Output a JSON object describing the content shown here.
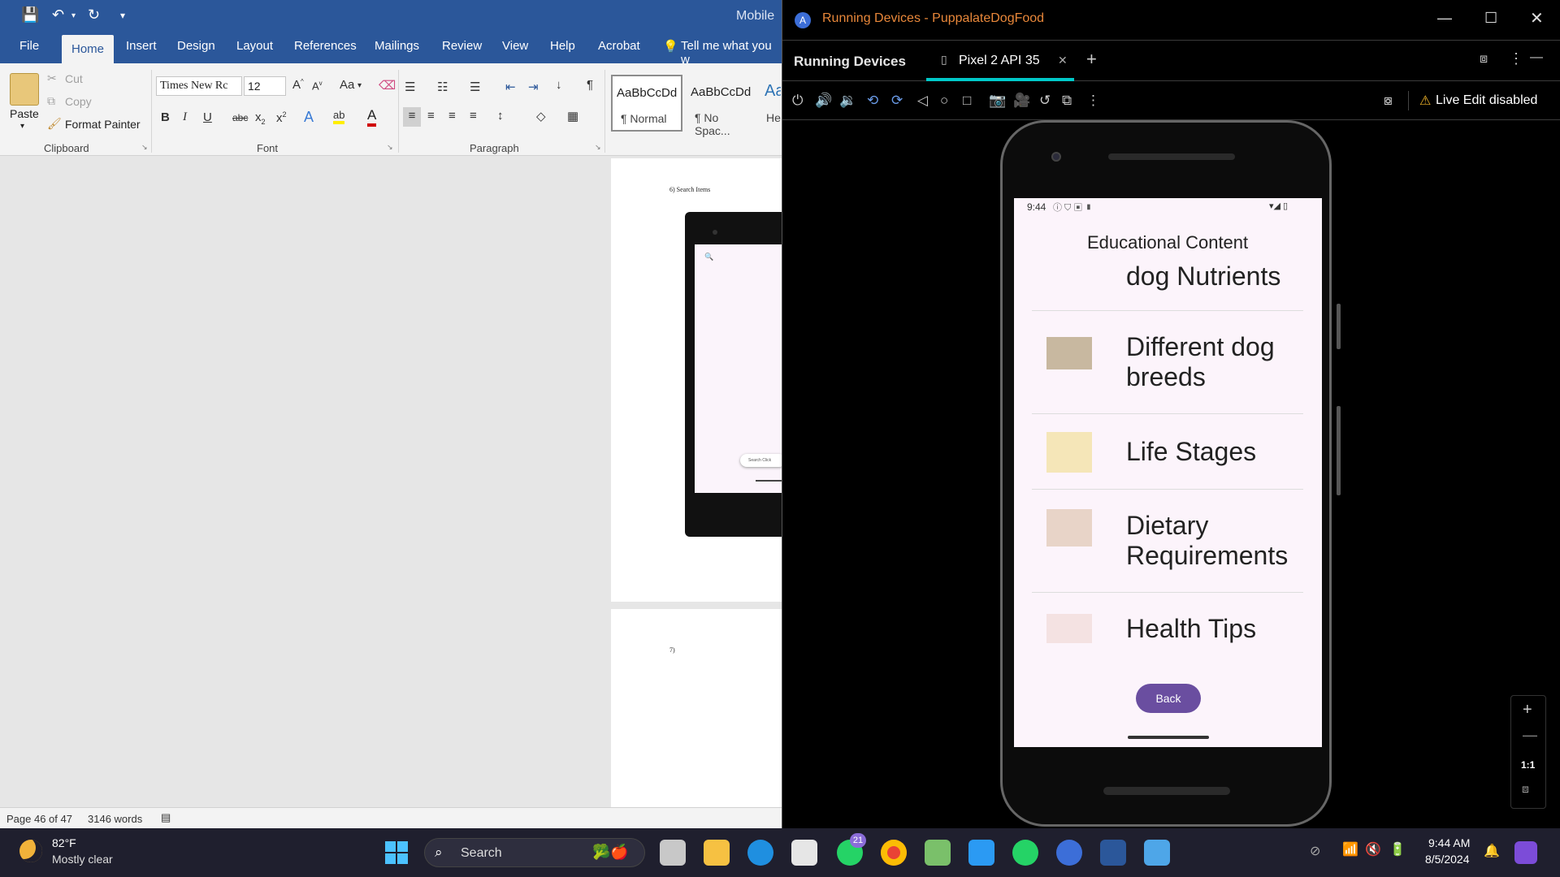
{
  "word": {
    "qat_title": "Mobile",
    "tabs": [
      "File",
      "Home",
      "Insert",
      "Design",
      "Layout",
      "References",
      "Mailings",
      "Review",
      "View",
      "Help",
      "Acrobat",
      "Tell me what you w"
    ],
    "clipboard": {
      "paste": "Paste",
      "cut": "Cut",
      "copy": "Copy",
      "format_painter": "Format Painter",
      "label": "Clipboard"
    },
    "font": {
      "name": "Times New Rc",
      "size": "12",
      "label": "Font",
      "aa": "Aa"
    },
    "paragraph": {
      "label": "Paragraph"
    },
    "styles": [
      {
        "preview": "AaBbCcDd",
        "name": "¶ Normal"
      },
      {
        "preview": "AaBbCcDd",
        "name": "¶ No Spac..."
      },
      {
        "preview": "Aa",
        "name": "He"
      }
    ],
    "page1_caption": "6) Search Items",
    "page2_caption": "7)",
    "thumb_search_text": "Search Click",
    "status": {
      "page": "Page 46 of 47",
      "words": "3146 words"
    }
  },
  "studio": {
    "window_title": "Running Devices - PuppalateDogFood",
    "panel_title": "Running Devices",
    "device_tab": "Pixel 2 API 35",
    "live_edit": "Live Edit disabled",
    "zoom_label": "1:1"
  },
  "app": {
    "status_time": "9:44",
    "header": "Educational Content",
    "subheader": "dog Nutrients",
    "items": [
      {
        "title1": "Different dog",
        "title2": "breeds",
        "icon": "dog-group-thumbnail"
      },
      {
        "title1": "Life Stages",
        "title2": "",
        "icon": "dog-life-stages-thumbnail"
      },
      {
        "title1": "Dietary",
        "title2": "Requirements",
        "icon": "dog-with-food-thumbnail"
      },
      {
        "title1": "Health Tips",
        "title2": "",
        "icon": "health-care-tips-thumbnail"
      }
    ],
    "back_button": "Back"
  },
  "taskbar": {
    "temperature": "82°F",
    "weather": "Mostly clear",
    "search": "Search",
    "whatsapp_badge": "21",
    "clock_time": "9:44 AM",
    "clock_date": "8/5/2024"
  },
  "colors": {
    "word_blue": "#2b579a",
    "accent_teal": "#00c8c8",
    "back_button": "#6a4ea0",
    "app_bg": "#fcf4fb",
    "title_orange": "#e8873a"
  }
}
